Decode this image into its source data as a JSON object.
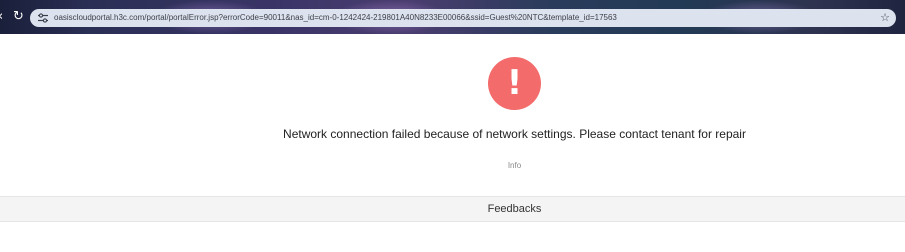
{
  "browser": {
    "url": "oasiscloudportal.h3c.com/portal/portalError.jsp?errorCode=90011&nas_id=cm-0-1242424-219801A40N8233E00066&ssid=Guest%20NTC&template_id=17563",
    "nav_icons": [
      "back-arrow-icon",
      "reload-icon"
    ],
    "site_icon": "site-settings-icon",
    "bookmark_icon": "star-icon"
  },
  "error": {
    "icon_glyph": "!",
    "icon_color": "#f36b6b",
    "message": "Network connection failed because of network settings. Please contact tenant for repair",
    "info_label": "Info"
  },
  "footer": {
    "feedbacks_label": "Feedbacks"
  }
}
